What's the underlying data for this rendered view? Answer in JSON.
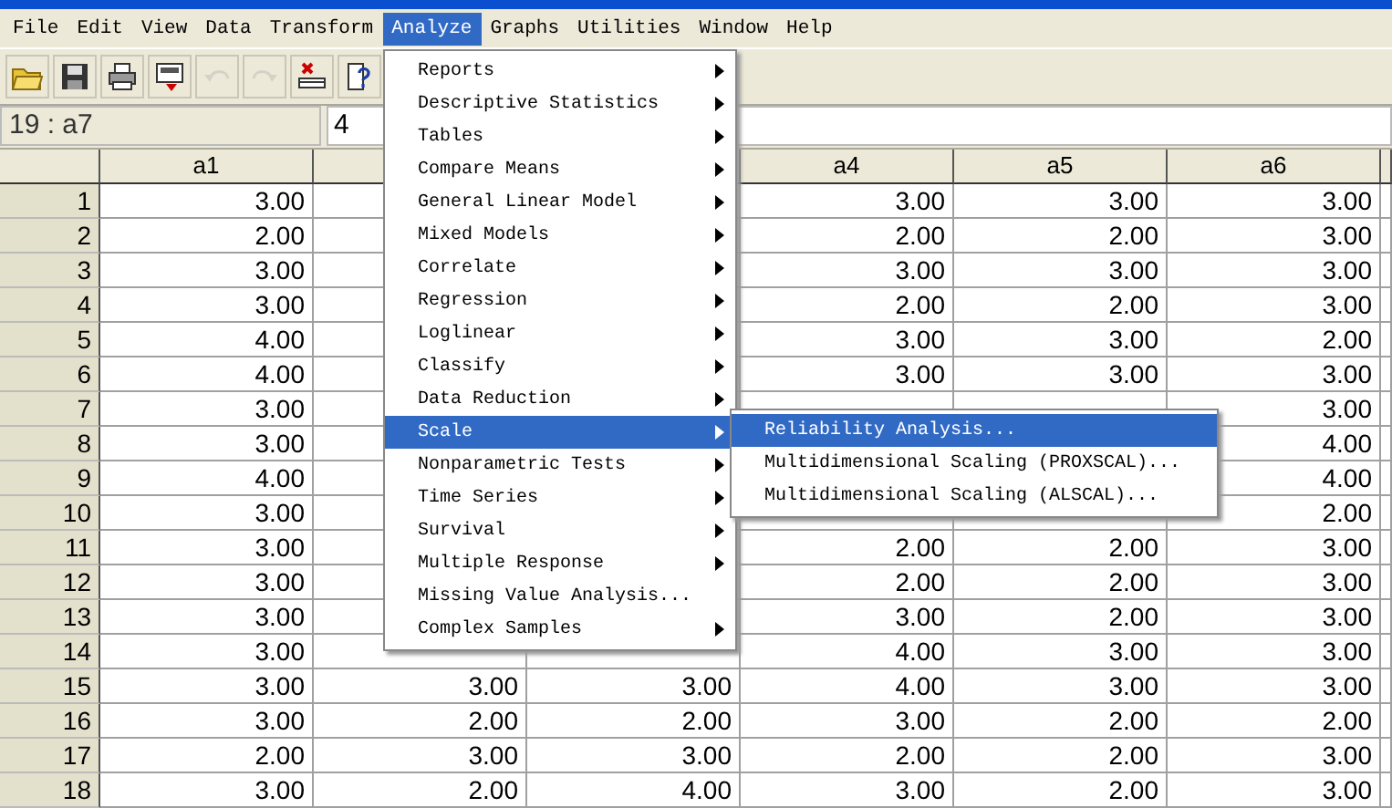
{
  "menu_bar": [
    {
      "label": "File",
      "selected": false
    },
    {
      "label": "Edit",
      "selected": false
    },
    {
      "label": "View",
      "selected": false
    },
    {
      "label": "Data",
      "selected": false
    },
    {
      "label": "Transform",
      "selected": false
    },
    {
      "label": "Analyze",
      "selected": true
    },
    {
      "label": "Graphs",
      "selected": false
    },
    {
      "label": "Utilities",
      "selected": false
    },
    {
      "label": "Window",
      "selected": false
    },
    {
      "label": "Help",
      "selected": false
    }
  ],
  "toolbar": [
    {
      "kind": "open",
      "disabled": false
    },
    {
      "kind": "save",
      "disabled": false
    },
    {
      "kind": "print",
      "disabled": false
    },
    {
      "kind": "dialog",
      "disabled": false
    },
    {
      "kind": "undo",
      "disabled": true
    },
    {
      "kind": "redo",
      "disabled": true
    },
    {
      "kind": "goto",
      "disabled": false
    },
    {
      "kind": "variables",
      "disabled": false
    }
  ],
  "cell_editor": {
    "cell": "19 : a7",
    "value": "4"
  },
  "grid": {
    "columns": [
      "a1",
      null,
      null,
      "a4",
      "a5",
      "a6"
    ],
    "rows": [
      {
        "row": "1",
        "cells": [
          "3.00",
          null,
          null,
          "3.00",
          "3.00",
          "3.00"
        ]
      },
      {
        "row": "2",
        "cells": [
          "2.00",
          null,
          null,
          "2.00",
          "2.00",
          "3.00"
        ]
      },
      {
        "row": "3",
        "cells": [
          "3.00",
          null,
          null,
          "3.00",
          "3.00",
          "3.00"
        ]
      },
      {
        "row": "4",
        "cells": [
          "3.00",
          null,
          null,
          "2.00",
          "2.00",
          "3.00"
        ]
      },
      {
        "row": "5",
        "cells": [
          "4.00",
          null,
          null,
          "3.00",
          "3.00",
          "2.00"
        ]
      },
      {
        "row": "6",
        "cells": [
          "4.00",
          null,
          null,
          "3.00",
          "3.00",
          "3.00"
        ]
      },
      {
        "row": "7",
        "cells": [
          "3.00",
          null,
          null,
          null,
          null,
          "3.00"
        ]
      },
      {
        "row": "8",
        "cells": [
          "3.00",
          null,
          null,
          null,
          null,
          "4.00"
        ]
      },
      {
        "row": "9",
        "cells": [
          "4.00",
          null,
          null,
          null,
          null,
          "4.00"
        ]
      },
      {
        "row": "10",
        "cells": [
          "3.00",
          null,
          null,
          null,
          null,
          "2.00"
        ]
      },
      {
        "row": "11",
        "cells": [
          "3.00",
          null,
          null,
          "2.00",
          "2.00",
          "3.00"
        ]
      },
      {
        "row": "12",
        "cells": [
          "3.00",
          null,
          null,
          "2.00",
          "2.00",
          "3.00"
        ]
      },
      {
        "row": "13",
        "cells": [
          "3.00",
          null,
          null,
          "3.00",
          "2.00",
          "3.00"
        ]
      },
      {
        "row": "14",
        "cells": [
          "3.00",
          null,
          null,
          "4.00",
          "3.00",
          "3.00"
        ]
      },
      {
        "row": "15",
        "cells": [
          "3.00",
          "3.00",
          "3.00",
          "4.00",
          "3.00",
          "3.00"
        ]
      },
      {
        "row": "16",
        "cells": [
          "3.00",
          "2.00",
          "2.00",
          "3.00",
          "2.00",
          "2.00"
        ]
      },
      {
        "row": "17",
        "cells": [
          "2.00",
          "3.00",
          "3.00",
          "2.00",
          "2.00",
          "3.00"
        ]
      },
      {
        "row": "18",
        "cells": [
          "3.00",
          "2.00",
          "4.00",
          "3.00",
          "2.00",
          "3.00"
        ]
      }
    ]
  },
  "analyze_menu": {
    "items": [
      {
        "label": "Reports",
        "submenu": true,
        "selected": false
      },
      {
        "label": "Descriptive Statistics",
        "submenu": true,
        "selected": false
      },
      {
        "label": "Tables",
        "submenu": true,
        "selected": false
      },
      {
        "label": "Compare Means",
        "submenu": true,
        "selected": false
      },
      {
        "label": "General Linear Model",
        "submenu": true,
        "selected": false
      },
      {
        "label": "Mixed Models",
        "submenu": true,
        "selected": false
      },
      {
        "label": "Correlate",
        "submenu": true,
        "selected": false
      },
      {
        "label": "Regression",
        "submenu": true,
        "selected": false
      },
      {
        "label": "Loglinear",
        "submenu": true,
        "selected": false
      },
      {
        "label": "Classify",
        "submenu": true,
        "selected": false
      },
      {
        "label": "Data Reduction",
        "submenu": true,
        "selected": false
      },
      {
        "label": "Scale",
        "submenu": true,
        "selected": true
      },
      {
        "label": "Nonparametric Tests",
        "submenu": true,
        "selected": false
      },
      {
        "label": "Time Series",
        "submenu": true,
        "selected": false
      },
      {
        "label": "Survival",
        "submenu": true,
        "selected": false
      },
      {
        "label": "Multiple Response",
        "submenu": true,
        "selected": false
      },
      {
        "label": "Missing Value Analysis...",
        "submenu": false,
        "selected": false
      },
      {
        "label": "Complex Samples",
        "submenu": true,
        "selected": false
      }
    ]
  },
  "scale_submenu": {
    "items": [
      {
        "label": "Reliability Analysis...",
        "submenu": false,
        "selected": true
      },
      {
        "label": "Multidimensional Scaling (PROXSCAL)...",
        "submenu": false,
        "selected": false
      },
      {
        "label": "Multidimensional Scaling (ALSCAL)...",
        "submenu": false,
        "selected": false
      }
    ]
  }
}
